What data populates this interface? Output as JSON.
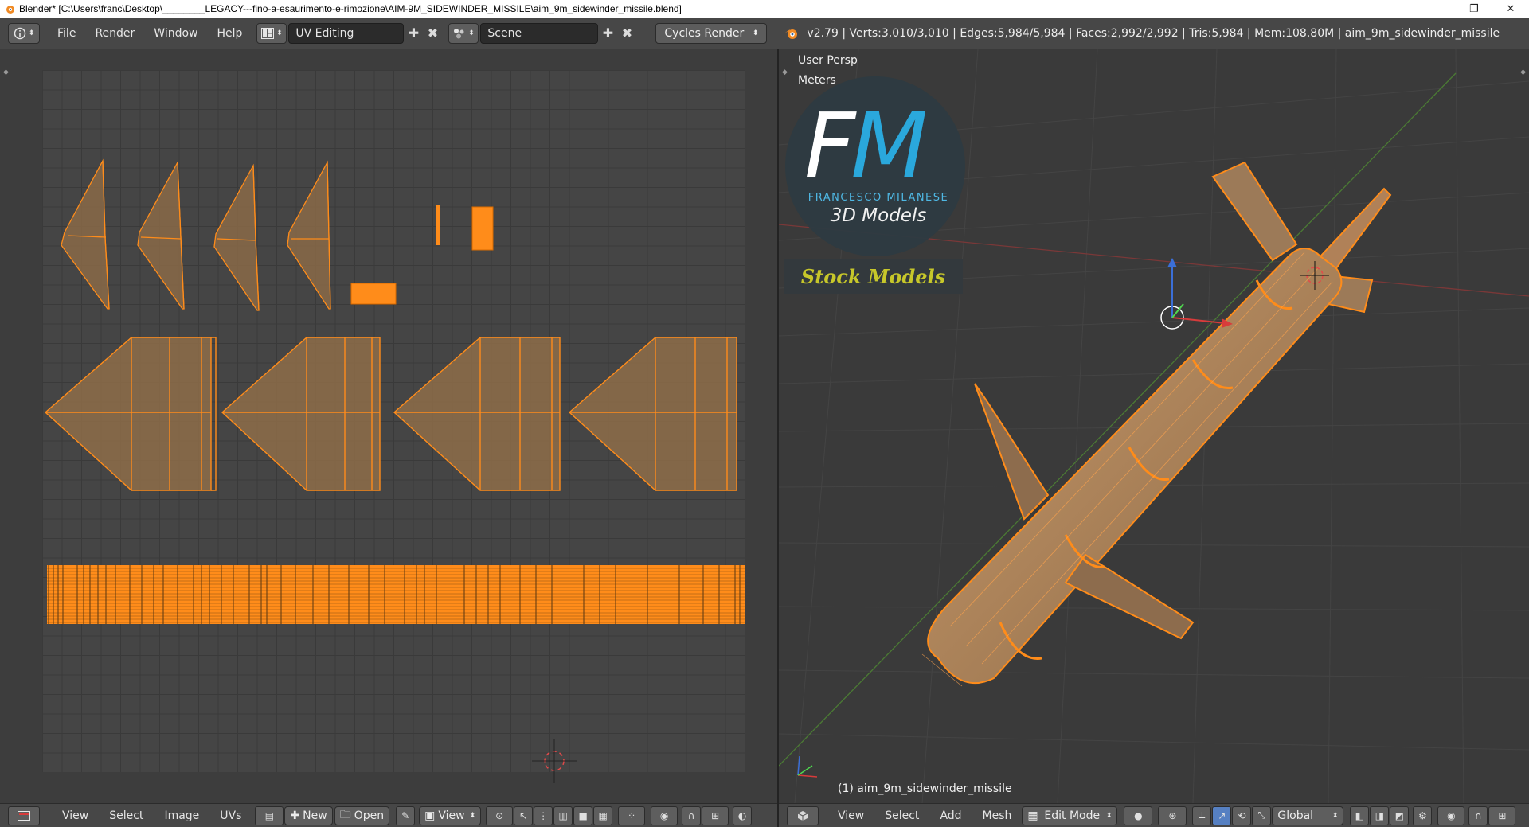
{
  "window": {
    "title": "Blender* [C:\\Users\\franc\\Desktop\\________LEGACY---fino-a-esaurimento-e-rimozione\\AIM-9M_SIDEWINDER_MISSILE\\aim_9m_sidewinder_missile.blend]",
    "minimize": "—",
    "maximize": "❐",
    "close": "✕"
  },
  "header": {
    "menus": [
      "File",
      "Render",
      "Window",
      "Help"
    ],
    "screen_layout": "UV Editing",
    "scene": "Scene",
    "render_engine": "Cycles Render",
    "stats": "v2.79 | Verts:3,010/3,010 | Edges:5,984/5,984 | Faces:2,992/2,992 | Tris:5,984 | Mem:108.80M | aim_9m_sidewinder_missile"
  },
  "uv_editor": {
    "menus": [
      "View",
      "Select",
      "Image",
      "UVs"
    ],
    "new_label": "New",
    "open_label": "Open",
    "view_label": "View"
  },
  "viewport": {
    "view_name": "User Persp",
    "units": "Meters",
    "object_label": "(1) aim_9m_sidewinder_missile",
    "menus": [
      "View",
      "Select",
      "Add",
      "Mesh"
    ],
    "mode": "Edit Mode",
    "orientation": "Global"
  },
  "logo": {
    "f": "F",
    "m": "M",
    "subtitle": "FRANCESCO MILANESE",
    "tagline": "3D Models",
    "badge": "Stock Models"
  },
  "colors": {
    "selection_orange": "#ff8c1a",
    "face_fill": "#8a6a48",
    "brand_blue": "#2aa8dc",
    "badge_yellow": "#c7c72a"
  }
}
